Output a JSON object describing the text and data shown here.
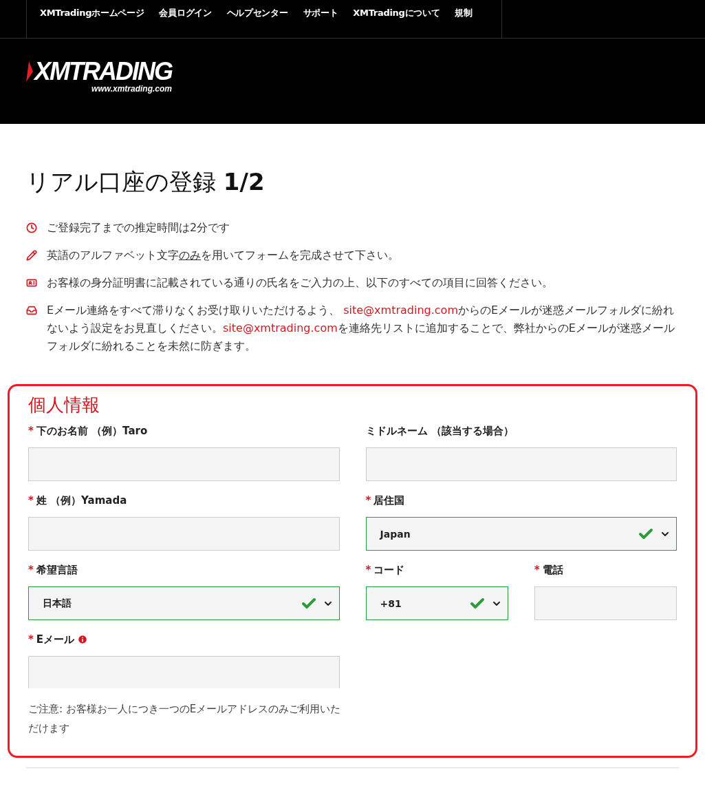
{
  "nav": [
    "XMTradingホームページ",
    "会員ログイン",
    "ヘルプセンター",
    "サポート",
    "XMTradingについて",
    "規制"
  ],
  "logo": {
    "wordmark": "XMTRADING",
    "url": "www.xmtrading.com"
  },
  "title": {
    "text": "リアル口座の登録",
    "step": "1/2"
  },
  "notes": [
    {
      "kind": "clock",
      "segments": [
        {
          "kind": "text",
          "text": "ご登録完了までの推定時間は2分です"
        }
      ]
    },
    {
      "kind": "pencil",
      "segments": [
        {
          "kind": "text",
          "text": "英語のアルファベット文字"
        },
        {
          "kind": "underline",
          "text": "のみ"
        },
        {
          "kind": "text",
          "text": "を用いてフォームを完成させて下さい。"
        }
      ]
    },
    {
      "kind": "card",
      "segments": [
        {
          "kind": "text",
          "text": "お客様の身分証明書に記載されている通りの氏名をご入力の上、以下のすべての項目に回答ください。"
        }
      ]
    },
    {
      "kind": "inbox",
      "segments": [
        {
          "kind": "text",
          "text": "Eメール連絡をすべて滞りなくお受け取りいただけるよう、 "
        },
        {
          "kind": "link",
          "text": "site@xmtrading.com"
        },
        {
          "kind": "text",
          "text": "からのEメールが迷惑メールフォルダに紛れないよう設定をお見直しください。"
        },
        {
          "kind": "link",
          "text": "site@xmtrading.com"
        },
        {
          "kind": "text",
          "text": "を連絡先リストに追加することで、弊社からのEメールが迷惑メールフォルダに紛れることを未然に防ぎます。"
        }
      ]
    }
  ],
  "section": {
    "heading": "個人情報",
    "rows": [
      [
        {
          "kind": "text",
          "required_mark": "*",
          "label": "下のお名前 （例）Taro",
          "valid": false
        },
        {
          "kind": "text",
          "label": "ミドルネーム （該当する場合）",
          "valid": false
        }
      ],
      [
        {
          "kind": "text",
          "required_mark": "*",
          "label": "姓 （例）Yamada",
          "valid": false
        },
        {
          "kind": "select",
          "required_mark": "*",
          "label": "居住国",
          "valid": true,
          "value": "Japan"
        }
      ],
      [
        {
          "kind": "select",
          "required_mark": "*",
          "label": "希望言語",
          "valid": true,
          "value": "日本語"
        },
        {
          "kind": "select",
          "required_mark": "*",
          "label": "コード",
          "valid": true,
          "value": "+81"
        },
        {
          "kind": "text",
          "required_mark": "*",
          "label": "電話",
          "valid": false
        }
      ],
      [
        {
          "kind": "text",
          "required_mark": "*",
          "label": "Eメール",
          "valid": false,
          "info": true,
          "cut": true
        }
      ]
    ],
    "note": "ご注意: お客様お一人につき一つのEメールアドレスのみご利用いただけます"
  }
}
